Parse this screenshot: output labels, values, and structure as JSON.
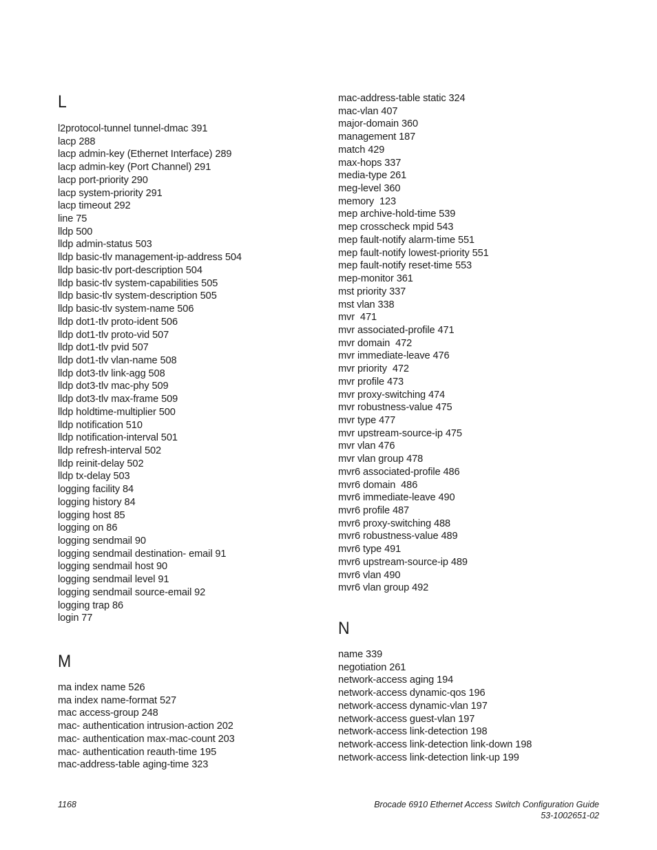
{
  "left_column": {
    "sections": [
      {
        "letter": "L",
        "entries": [
          "l2protocol-tunnel tunnel-dmac 391",
          "lacp 288",
          "lacp admin-key (Ethernet Interface) 289",
          "lacp admin-key (Port Channel) 291",
          "lacp port-priority 290",
          "lacp system-priority 291",
          "lacp timeout 292",
          "line 75",
          "lldp 500",
          "lldp admin-status 503",
          "lldp basic-tlv management-ip-address 504",
          "lldp basic-tlv port-description 504",
          "lldp basic-tlv system-capabilities 505",
          "lldp basic-tlv system-description 505",
          "lldp basic-tlv system-name 506",
          "lldp dot1-tlv proto-ident 506",
          "lldp dot1-tlv proto-vid 507",
          "lldp dot1-tlv pvid 507",
          "lldp dot1-tlv vlan-name 508",
          "lldp dot3-tlv link-agg 508",
          "lldp dot3-tlv mac-phy 509",
          "lldp dot3-tlv max-frame 509",
          "lldp holdtime-multiplier 500",
          "lldp notification 510",
          "lldp notification-interval 501",
          "lldp refresh-interval 502",
          "lldp reinit-delay 502",
          "lldp tx-delay 503",
          "logging facility 84",
          "logging history 84",
          "logging host 85",
          "logging on 86",
          "logging sendmail 90",
          "logging sendmail destination- email 91",
          "logging sendmail host 90",
          "logging sendmail level 91",
          "logging sendmail source-email 92",
          "logging trap 86",
          "login 77"
        ]
      },
      {
        "letter": "M",
        "entries": [
          "ma index name 526",
          "ma index name-format 527",
          "mac access-group 248",
          "mac- authentication intrusion-action 202",
          "mac- authentication max-mac-count 203",
          "mac- authentication reauth-time 195",
          "mac-address-table aging-time 323"
        ]
      }
    ]
  },
  "right_column": {
    "continued_entries": [
      "mac-address-table static 324",
      "mac-vlan 407",
      "major-domain 360",
      "management 187",
      "match 429",
      "max-hops 337",
      "media-type 261",
      "meg-level 360",
      "memory  123",
      "mep archive-hold-time 539",
      "mep crosscheck mpid 543",
      "mep fault-notify alarm-time 551",
      "mep fault-notify lowest-priority 551",
      "mep fault-notify reset-time 553",
      "mep-monitor 361",
      "mst priority 337",
      "mst vlan 338",
      "mvr  471",
      "mvr associated-profile 471",
      "mvr domain  472",
      "mvr immediate-leave 476",
      "mvr priority  472",
      "mvr profile 473",
      "mvr proxy-switching 474",
      "mvr robustness-value 475",
      "mvr type 477",
      "mvr upstream-source-ip 475",
      "mvr vlan 476",
      "mvr vlan group 478",
      "mvr6 associated-profile 486",
      "mvr6 domain  486",
      "mvr6 immediate-leave 490",
      "mvr6 profile 487",
      "mvr6 proxy-switching 488",
      "mvr6 robustness-value 489",
      "mvr6 type 491",
      "mvr6 upstream-source-ip 489",
      "mvr6 vlan 490",
      "mvr6 vlan group 492"
    ],
    "sections": [
      {
        "letter": "N",
        "entries": [
          "name 339",
          "negotiation 261",
          "network-access aging 194",
          "network-access dynamic-qos 196",
          "network-access dynamic-vlan 197",
          "network-access guest-vlan 197",
          "network-access link-detection 198",
          "network-access link-detection link-down 198",
          "network-access link-detection link-up 199"
        ]
      }
    ]
  },
  "footer": {
    "page_number": "1168",
    "guide_title": "Brocade 6910 Ethernet Access Switch Configuration Guide",
    "doc_number": "53-1002651-02"
  }
}
